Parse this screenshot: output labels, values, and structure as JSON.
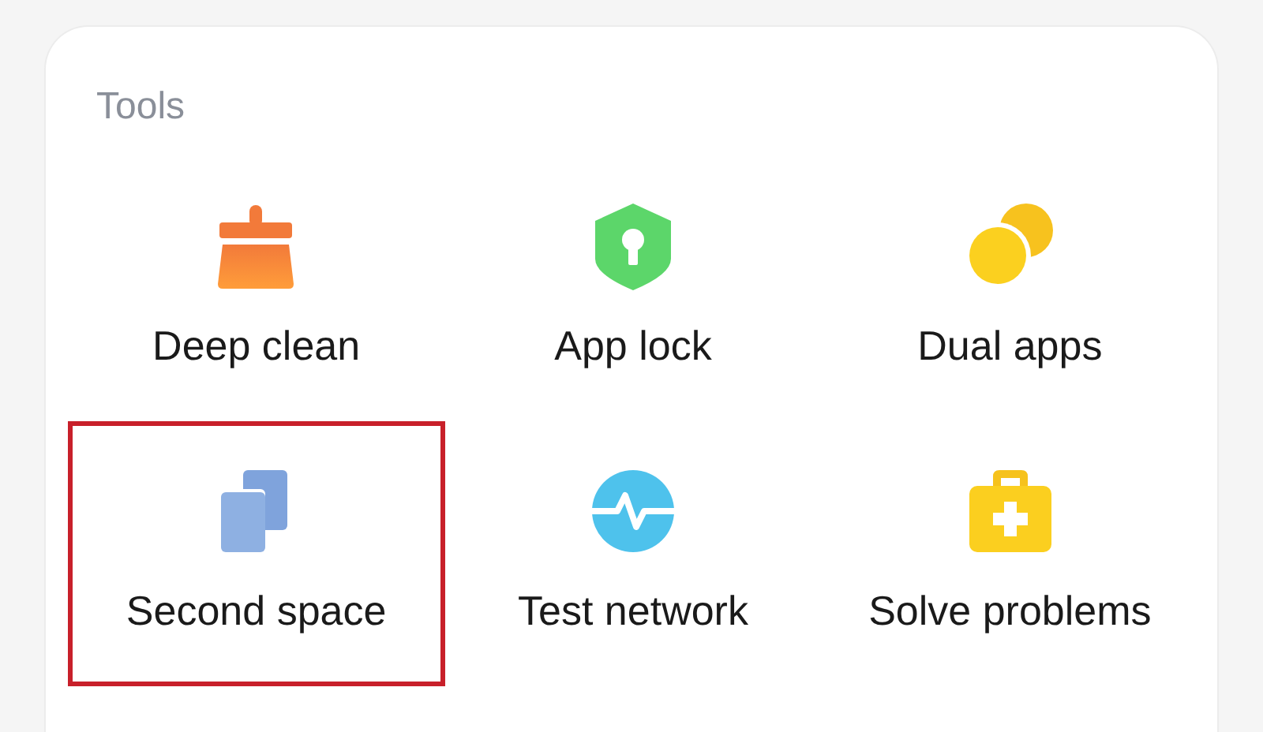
{
  "section": {
    "title": "Tools"
  },
  "tools": [
    {
      "kind": "broom",
      "label": "Deep clean",
      "highlighted": false
    },
    {
      "kind": "shield",
      "label": "App lock",
      "highlighted": false
    },
    {
      "kind": "circles",
      "label": "Dual apps",
      "highlighted": false
    },
    {
      "kind": "pages",
      "label": "Second space",
      "highlighted": true
    },
    {
      "kind": "pulse",
      "label": "Test network",
      "highlighted": false
    },
    {
      "kind": "kit",
      "label": "Solve problems",
      "highlighted": false
    }
  ]
}
